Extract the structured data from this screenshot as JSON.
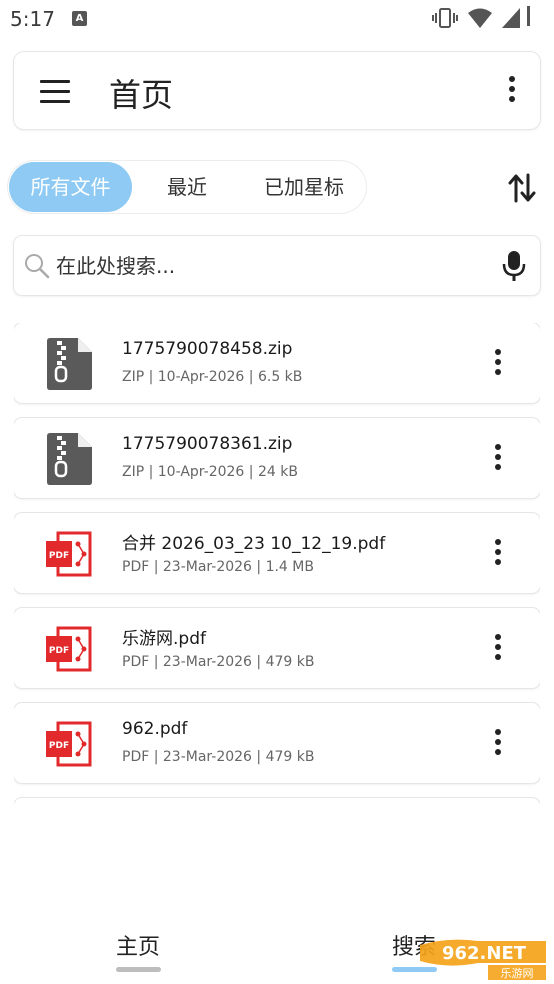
{
  "status_bar": {
    "time": "5:17",
    "notification_letter": "A"
  },
  "app_bar": {
    "title": "首页"
  },
  "tabs": [
    {
      "label": "所有文件",
      "active": true
    },
    {
      "label": "最近",
      "active": false
    },
    {
      "label": "已加星标",
      "active": false
    }
  ],
  "search": {
    "placeholder": "在此处搜索..."
  },
  "files": [
    {
      "name": "1775790078458.zip",
      "meta": "ZIP | 10-Apr-2026 | 6.5 kB",
      "icon": "zip-file-icon"
    },
    {
      "name": "1775790078361.zip",
      "meta": "ZIP | 10-Apr-2026 | 24 kB",
      "icon": "zip-file-icon"
    },
    {
      "name": "合并 2026_03_23 10_12_19.pdf",
      "meta": "PDF | 23-Mar-2026 | 1.4 MB",
      "icon": "pdf-file-icon"
    },
    {
      "name": "乐游网.pdf",
      "meta": "PDF | 23-Mar-2026 | 479 kB",
      "icon": "pdf-file-icon"
    },
    {
      "name": "962.pdf",
      "meta": "PDF | 23-Mar-2026 | 479 kB",
      "icon": "pdf-file-icon"
    }
  ],
  "bottom_nav": {
    "home_label": "主页",
    "search_label": "搜索"
  },
  "watermark": {
    "text": "962.NET",
    "subtext": "乐游网"
  },
  "colors": {
    "accent": "#8ecaf3",
    "pdf_red": "#e2292b",
    "zip_gray": "#555555"
  }
}
